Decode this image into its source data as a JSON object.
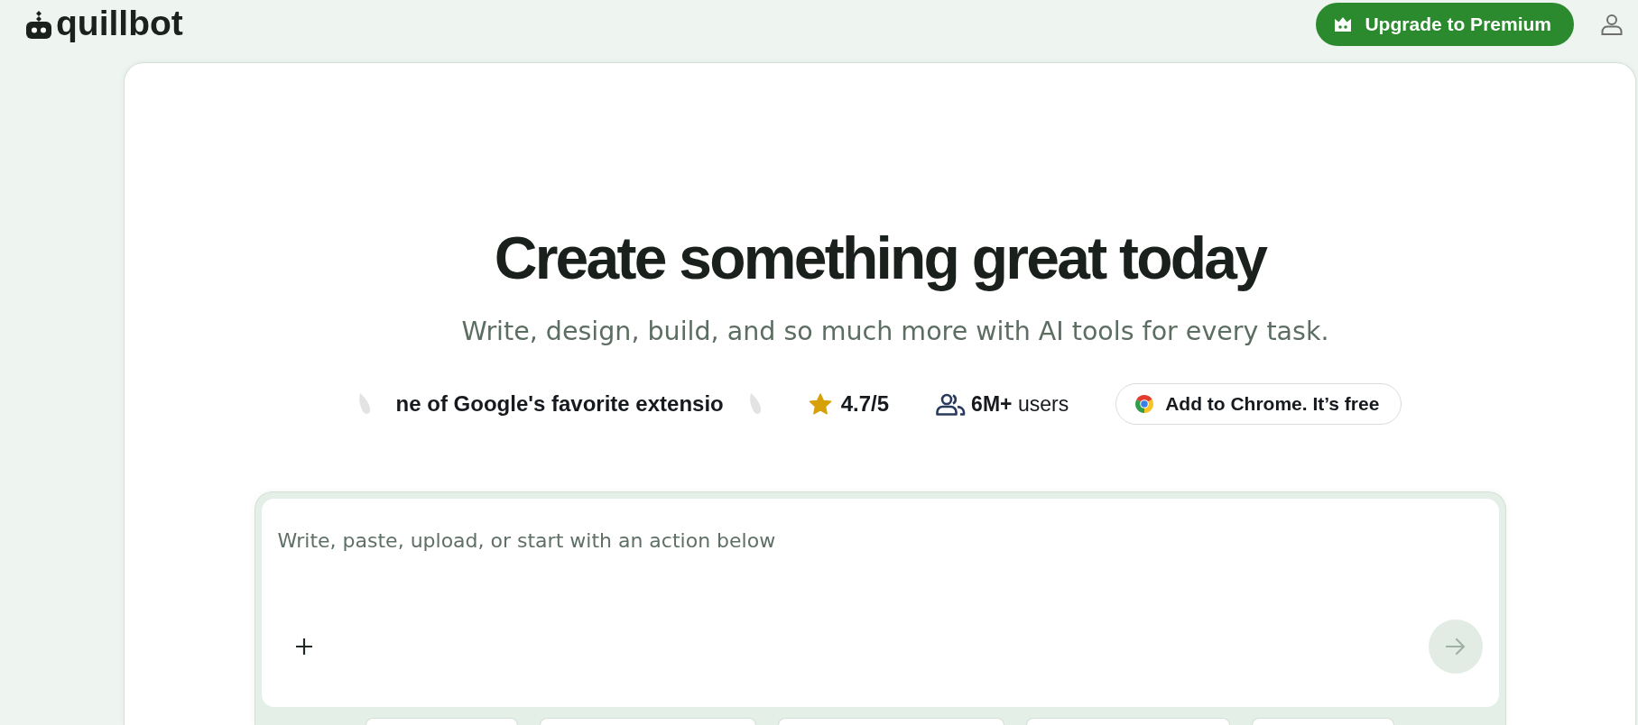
{
  "header": {
    "logo": "quillbot",
    "upgrade_button": "Upgrade to Premium"
  },
  "hero": {
    "title": "Create something great today",
    "subtitle": "Write, design, build, and so much more with AI tools for every task."
  },
  "stats": {
    "award": "ne of Google's favorite extensio",
    "rating": "4.7/5",
    "users": "**6M+** users",
    "chrome_button": "Add to Chrome. It’s free"
  },
  "composer": {
    "placeholder": "Write, paste, upload, or start with an action below",
    "send_button": {
      "disabled": true
    }
  }
}
